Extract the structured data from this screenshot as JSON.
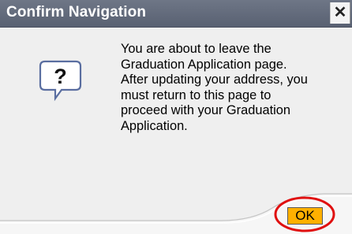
{
  "dialog": {
    "title": "Confirm Navigation",
    "close_glyph": "✕",
    "icon": "question-bubble-icon",
    "message_lines": [
      "You are about to leave the",
      "Graduation Application page.",
      "After updating your address, you",
      "must return to this page to",
      "proceed with your Graduation",
      "Application."
    ],
    "ok_label": "OK"
  },
  "colors": {
    "titlebar": "#626a7a",
    "body": "#efefef",
    "ok_button": "#ffb000",
    "highlight": "#e01010"
  }
}
